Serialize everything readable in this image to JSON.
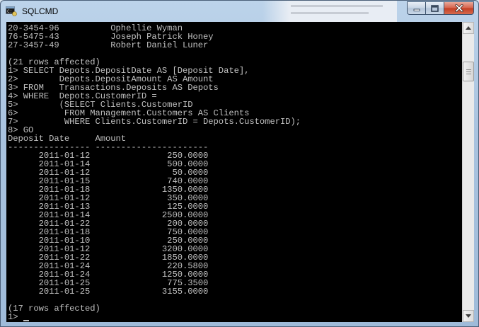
{
  "window": {
    "title": "SQLCMD",
    "buttons": {
      "minimize": "minimize",
      "maximize": "maximize",
      "close": "close"
    }
  },
  "console": {
    "lines": [
      "20-3454-96          Ophellie Wyman",
      "76-5475-43          Joseph Patrick Honey",
      "27-3457-49          Robert Daniel Luner",
      "",
      "(21 rows affected)",
      "1> SELECT Depots.DepositDate AS [Deposit Date],",
      "2>        Depots.DepositAmount AS Amount",
      "3> FROM   Transactions.Deposits AS Depots",
      "4> WHERE  Depots.CustomerID =",
      "5>        (SELECT Clients.CustomerID",
      "6>         FROM Management.Customers AS Clients",
      "7>         WHERE Clients.CustomerID = Depots.CustomerID);",
      "8> GO",
      "Deposit Date     Amount",
      "---------------- ----------------------",
      "      2011-01-12               250.0000",
      "      2011-01-14               500.0000",
      "      2011-01-12                50.0000",
      "      2011-01-15               740.0000",
      "      2011-01-18              1350.0000",
      "      2011-01-12               350.0000",
      "      2011-01-13               125.0000",
      "      2011-01-14              2500.0000",
      "      2011-01-22               200.0000",
      "      2011-01-18               750.0000",
      "      2011-01-10               250.0000",
      "      2011-01-12              3200.0000",
      "      2011-01-22              1850.0000",
      "      2011-01-24               220.5800",
      "      2011-01-24              1250.0000",
      "      2011-01-25               775.3500",
      "      2011-01-25              3155.0000",
      "",
      "(17 rows affected)",
      "1> "
    ]
  }
}
